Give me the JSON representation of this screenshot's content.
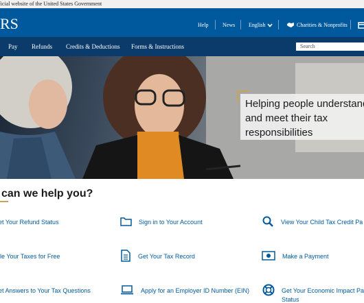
{
  "gov_banner": {
    "text": "ficial website of the United States Government"
  },
  "header": {
    "logo": "RS",
    "links": {
      "help": "Help",
      "news": "News",
      "language": "English",
      "charities": "Charities & Nonprofits"
    }
  },
  "nav": {
    "items": [
      "Pay",
      "Refunds",
      "Credits & Deductions",
      "Forms & Instructions"
    ],
    "search_placeholder": "Search"
  },
  "hero": {
    "callout": "Helping people understand and meet their tax responsibilities"
  },
  "help": {
    "title": "can we help you?",
    "links": [
      {
        "label": "et Your Refund Status",
        "icon": "none"
      },
      {
        "label": "Sign in to Your Account",
        "icon": "folder-icon"
      },
      {
        "label": "View Your Child Tax Credit Pa",
        "icon": "search-icon"
      },
      {
        "label": "ile Your Taxes for Free",
        "icon": "none"
      },
      {
        "label": "Get Your Tax Record",
        "icon": "document-icon"
      },
      {
        "label": "Make a Payment",
        "icon": "money-icon"
      },
      {
        "label": "et Answers to Your Tax Questions",
        "icon": "none"
      },
      {
        "label": "Apply for an Employer ID Number (EIN)",
        "icon": "laptop-icon"
      },
      {
        "label": "Get Your Economic Impact Pa",
        "label2": "Status",
        "icon": "lifebuoy-icon"
      }
    ]
  },
  "colors": {
    "header_blue": "#00599c",
    "nav_navy": "#0b3b6a",
    "link_blue": "#00599c",
    "accent_gold": "#c9a25b"
  }
}
